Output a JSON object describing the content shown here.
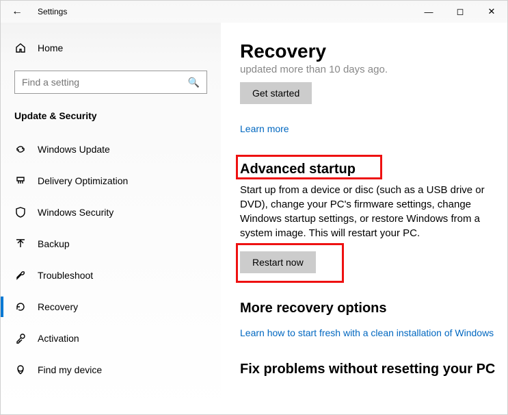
{
  "window": {
    "title": "Settings"
  },
  "sidebar": {
    "home": "Home",
    "search_placeholder": "Find a setting",
    "section": "Update & Security",
    "items": [
      {
        "label": "Windows Update"
      },
      {
        "label": "Delivery Optimization"
      },
      {
        "label": "Windows Security"
      },
      {
        "label": "Backup"
      },
      {
        "label": "Troubleshoot"
      },
      {
        "label": "Recovery"
      },
      {
        "label": "Activation"
      },
      {
        "label": "Find my device"
      }
    ]
  },
  "content": {
    "title": "Recovery",
    "cut_text": "updated more than 10 days ago.",
    "get_started": "Get started",
    "learn_more": "Learn more",
    "adv_heading": "Advanced startup",
    "adv_body": "Start up from a device or disc (such as a USB drive or DVD), change your PC's firmware settings, change Windows startup settings, or restore Windows from a system image. This will restart your PC.",
    "restart_now": "Restart now",
    "more_heading": "More recovery options",
    "more_link": "Learn how to start fresh with a clean installation of Windows",
    "fix_heading": "Fix problems without resetting your PC"
  }
}
